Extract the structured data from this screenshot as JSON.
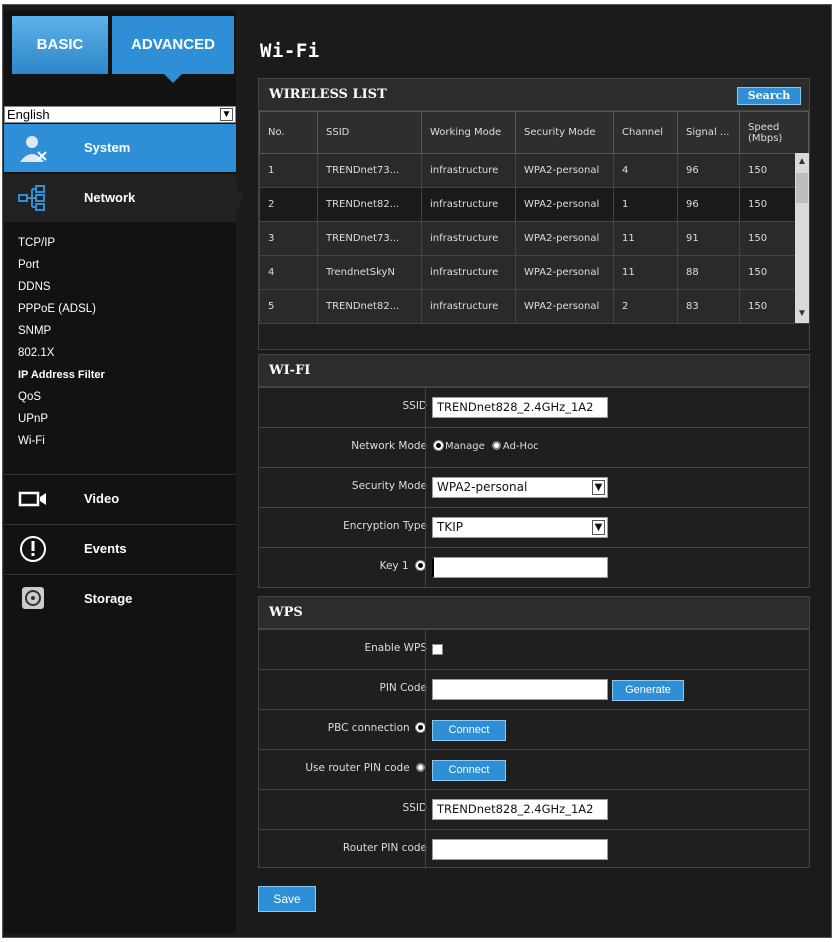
{
  "tabs": {
    "basic": "BASIC",
    "advanced": "ADVANCED"
  },
  "language": {
    "selected": "English"
  },
  "nav": {
    "system": "System",
    "network": "Network",
    "video": "Video",
    "events": "Events",
    "storage": "Storage",
    "network_items": [
      "TCP/IP",
      "Port",
      "DDNS",
      "PPPoE (ADSL)",
      "SNMP",
      "802.1X",
      "IP Address Filter",
      "QoS",
      "UPnP",
      "Wi-Fi"
    ]
  },
  "page": {
    "title": "Wi-Fi"
  },
  "wireless_list": {
    "title": "WIRELESS LIST",
    "search_label": "Search",
    "columns": [
      "No.",
      "SSID",
      "Working Mode",
      "Security Mode",
      "Channel",
      "Signal ...",
      "Speed (Mbps)"
    ],
    "rows": [
      [
        "1",
        "TRENDnet73...",
        "infrastructure",
        "WPA2-personal",
        "4",
        "96",
        "150"
      ],
      [
        "2",
        "TRENDnet82...",
        "infrastructure",
        "WPA2-personal",
        "1",
        "96",
        "150"
      ],
      [
        "3",
        "TRENDnet73...",
        "infrastructure",
        "WPA2-personal",
        "11",
        "91",
        "150"
      ],
      [
        "4",
        "TrendnetSkyN",
        "infrastructure",
        "WPA2-personal",
        "11",
        "88",
        "150"
      ],
      [
        "5",
        "TRENDnet82...",
        "infrastructure",
        "WPA2-personal",
        "2",
        "83",
        "150"
      ]
    ]
  },
  "wifi": {
    "title": "WI-FI",
    "ssid_label": "SSID",
    "ssid_value": "TRENDnet828_2.4GHz_1A2",
    "network_mode_label": "Network Mode",
    "mode_manage": "Manage",
    "mode_adhoc": "Ad-Hoc",
    "security_mode_label": "Security Mode",
    "security_mode_value": "WPA2-personal",
    "encryption_label": "Encryption Type",
    "encryption_value": "TKIP",
    "key1_label": "Key 1",
    "key1_value": ""
  },
  "wps": {
    "title": "WPS",
    "enable_label": "Enable WPS",
    "pin_code_label": "PIN Code",
    "pin_code_value": "",
    "generate_label": "Generate",
    "pbc_label": "PBC connection",
    "connect_label": "Connect",
    "router_pin_label": "Use router PIN code",
    "ssid_label": "SSID",
    "ssid_value": "TRENDnet828_2.4GHz_1A2",
    "router_pin_code_label": "Router PIN code",
    "router_pin_code_value": ""
  },
  "save_label": "Save"
}
